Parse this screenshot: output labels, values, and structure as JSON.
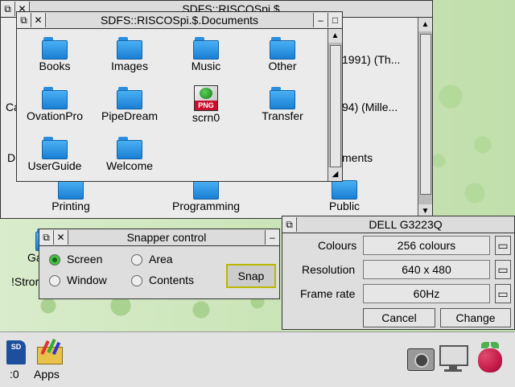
{
  "sdfs_root": {
    "title": "SDFS::RISCOSpi.$",
    "visible_labels": [
      "Printing",
      "Programming",
      "Public"
    ],
    "peek_labels": [
      "1991) (Th...",
      "94) (Mille...",
      "ments"
    ]
  },
  "documents": {
    "title": "SDFS::RISCOSpi.$.Documents",
    "items": [
      {
        "label": "Books",
        "icon": "folder-icon"
      },
      {
        "label": "Images",
        "icon": "folder-icon"
      },
      {
        "label": "Music",
        "icon": "folder-icon"
      },
      {
        "label": "Other",
        "icon": "folder-icon"
      },
      {
        "label": "OvationPro",
        "icon": "folder-icon"
      },
      {
        "label": "PipeDream",
        "icon": "folder-icon"
      },
      {
        "label": "scrn0",
        "icon": "png-file-icon",
        "badge": "PNG"
      },
      {
        "label": "Transfer",
        "icon": "folder-icon"
      },
      {
        "label": "UserGuide",
        "icon": "folder-icon"
      },
      {
        "label": "Welcome",
        "icon": "folder-icon"
      }
    ]
  },
  "left_edge_labels": [
    "Ca",
    "D"
  ],
  "desktop_label": "!Stror",
  "desktop_icon_label": "Ga",
  "snapper": {
    "title": "Snapper control",
    "options": {
      "screen": "Screen",
      "area": "Area",
      "window": "Window",
      "contents": "Contents"
    },
    "selected": "Screen",
    "snap_label": "Snap"
  },
  "display": {
    "title": "DELL G3223Q",
    "colours_label": "Colours",
    "colours_value": "256 colours",
    "resolution_label": "Resolution",
    "resolution_value": "640 x 480",
    "framerate_label": "Frame rate",
    "framerate_value": "60Hz",
    "cancel_label": "Cancel",
    "change_label": "Change"
  },
  "iconbar": {
    "sd_label": ":0",
    "apps_label": "Apps",
    "sd_badge": "SD"
  },
  "colors": {
    "accent": "#45c245",
    "folder": "#2a8ee0",
    "raspberry": "#c51a4a"
  }
}
